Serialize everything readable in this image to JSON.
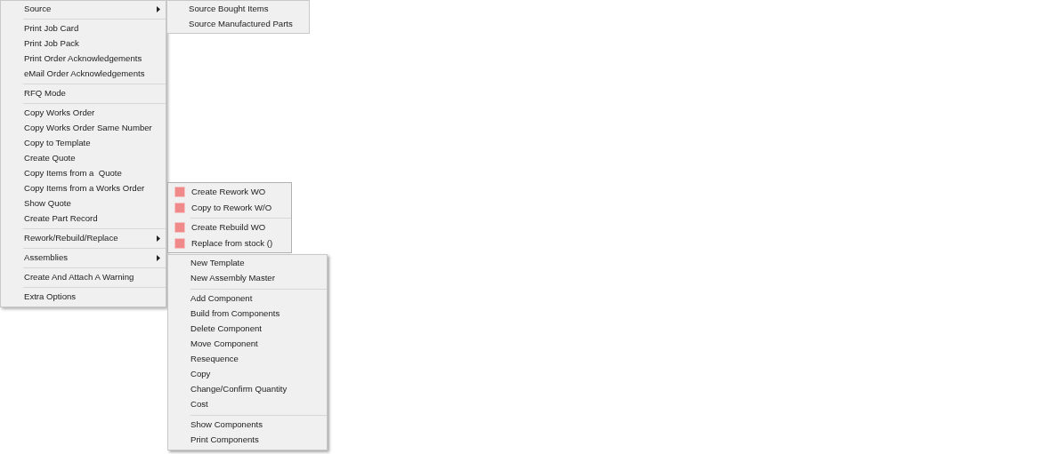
{
  "main_menu": {
    "items": [
      {
        "kind": "item",
        "label": "Source",
        "has_submenu": true
      },
      {
        "kind": "separator"
      },
      {
        "kind": "item",
        "label": "Print Job Card",
        "has_submenu": false
      },
      {
        "kind": "item",
        "label": "Print Job Pack",
        "has_submenu": false
      },
      {
        "kind": "item",
        "label": "Print Order Acknowledgements",
        "has_submenu": false
      },
      {
        "kind": "item",
        "label": "eMail Order Acknowledgements",
        "has_submenu": false
      },
      {
        "kind": "separator"
      },
      {
        "kind": "item",
        "label": "RFQ Mode",
        "has_submenu": false
      },
      {
        "kind": "separator"
      },
      {
        "kind": "item",
        "label": "Copy Works Order",
        "has_submenu": false
      },
      {
        "kind": "item",
        "label": "Copy Works Order Same Number",
        "has_submenu": false
      },
      {
        "kind": "item",
        "label": "Copy to Template",
        "has_submenu": false
      },
      {
        "kind": "item",
        "label": "Create Quote",
        "has_submenu": false
      },
      {
        "kind": "item",
        "label": "Copy Items from a  Quote",
        "has_submenu": false
      },
      {
        "kind": "item",
        "label": "Copy Items from a Works Order",
        "has_submenu": false
      },
      {
        "kind": "item",
        "label": "Show Quote",
        "has_submenu": false
      },
      {
        "kind": "item",
        "label": "Create Part Record",
        "has_submenu": false
      },
      {
        "kind": "separator"
      },
      {
        "kind": "item",
        "label": "Rework/Rebuild/Replace",
        "has_submenu": true
      },
      {
        "kind": "separator"
      },
      {
        "kind": "item",
        "label": "Assemblies",
        "has_submenu": true
      },
      {
        "kind": "separator"
      },
      {
        "kind": "item",
        "label": "Create And Attach A Warning",
        "has_submenu": false
      },
      {
        "kind": "separator"
      },
      {
        "kind": "item",
        "label": "Extra Options",
        "has_submenu": false
      }
    ]
  },
  "source_submenu": {
    "items": [
      {
        "kind": "item",
        "label": "Source Bought Items",
        "has_icon": false
      },
      {
        "kind": "item",
        "label": "Source Manufactured Parts",
        "has_icon": false
      }
    ]
  },
  "rework_submenu": {
    "items": [
      {
        "kind": "item",
        "label": "Create Rework WO",
        "has_icon": true
      },
      {
        "kind": "item",
        "label": "Copy to Rework W/O",
        "has_icon": true
      },
      {
        "kind": "separator"
      },
      {
        "kind": "item",
        "label": "Create Rebuild WO",
        "has_icon": true
      },
      {
        "kind": "item",
        "label": "Replace from stock ()",
        "has_icon": true
      }
    ]
  },
  "assemblies_submenu": {
    "items": [
      {
        "kind": "item",
        "label": "New Template",
        "has_icon": false
      },
      {
        "kind": "item",
        "label": "New Assembly Master",
        "has_icon": false
      },
      {
        "kind": "separator"
      },
      {
        "kind": "item",
        "label": "Add Component",
        "has_icon": false
      },
      {
        "kind": "item",
        "label": "Build from Components",
        "has_icon": false
      },
      {
        "kind": "item",
        "label": "Delete Component",
        "has_icon": false
      },
      {
        "kind": "item",
        "label": "Move Component",
        "has_icon": false
      },
      {
        "kind": "item",
        "label": "Resequence",
        "has_icon": false
      },
      {
        "kind": "item",
        "label": "Copy",
        "has_icon": false
      },
      {
        "kind": "item",
        "label": "Change/Confirm Quantity",
        "has_icon": false
      },
      {
        "kind": "item",
        "label": "Cost",
        "has_icon": false
      },
      {
        "kind": "separator"
      },
      {
        "kind": "item",
        "label": "Show Components",
        "has_icon": false
      },
      {
        "kind": "item",
        "label": "Print Components",
        "has_icon": false
      }
    ]
  }
}
